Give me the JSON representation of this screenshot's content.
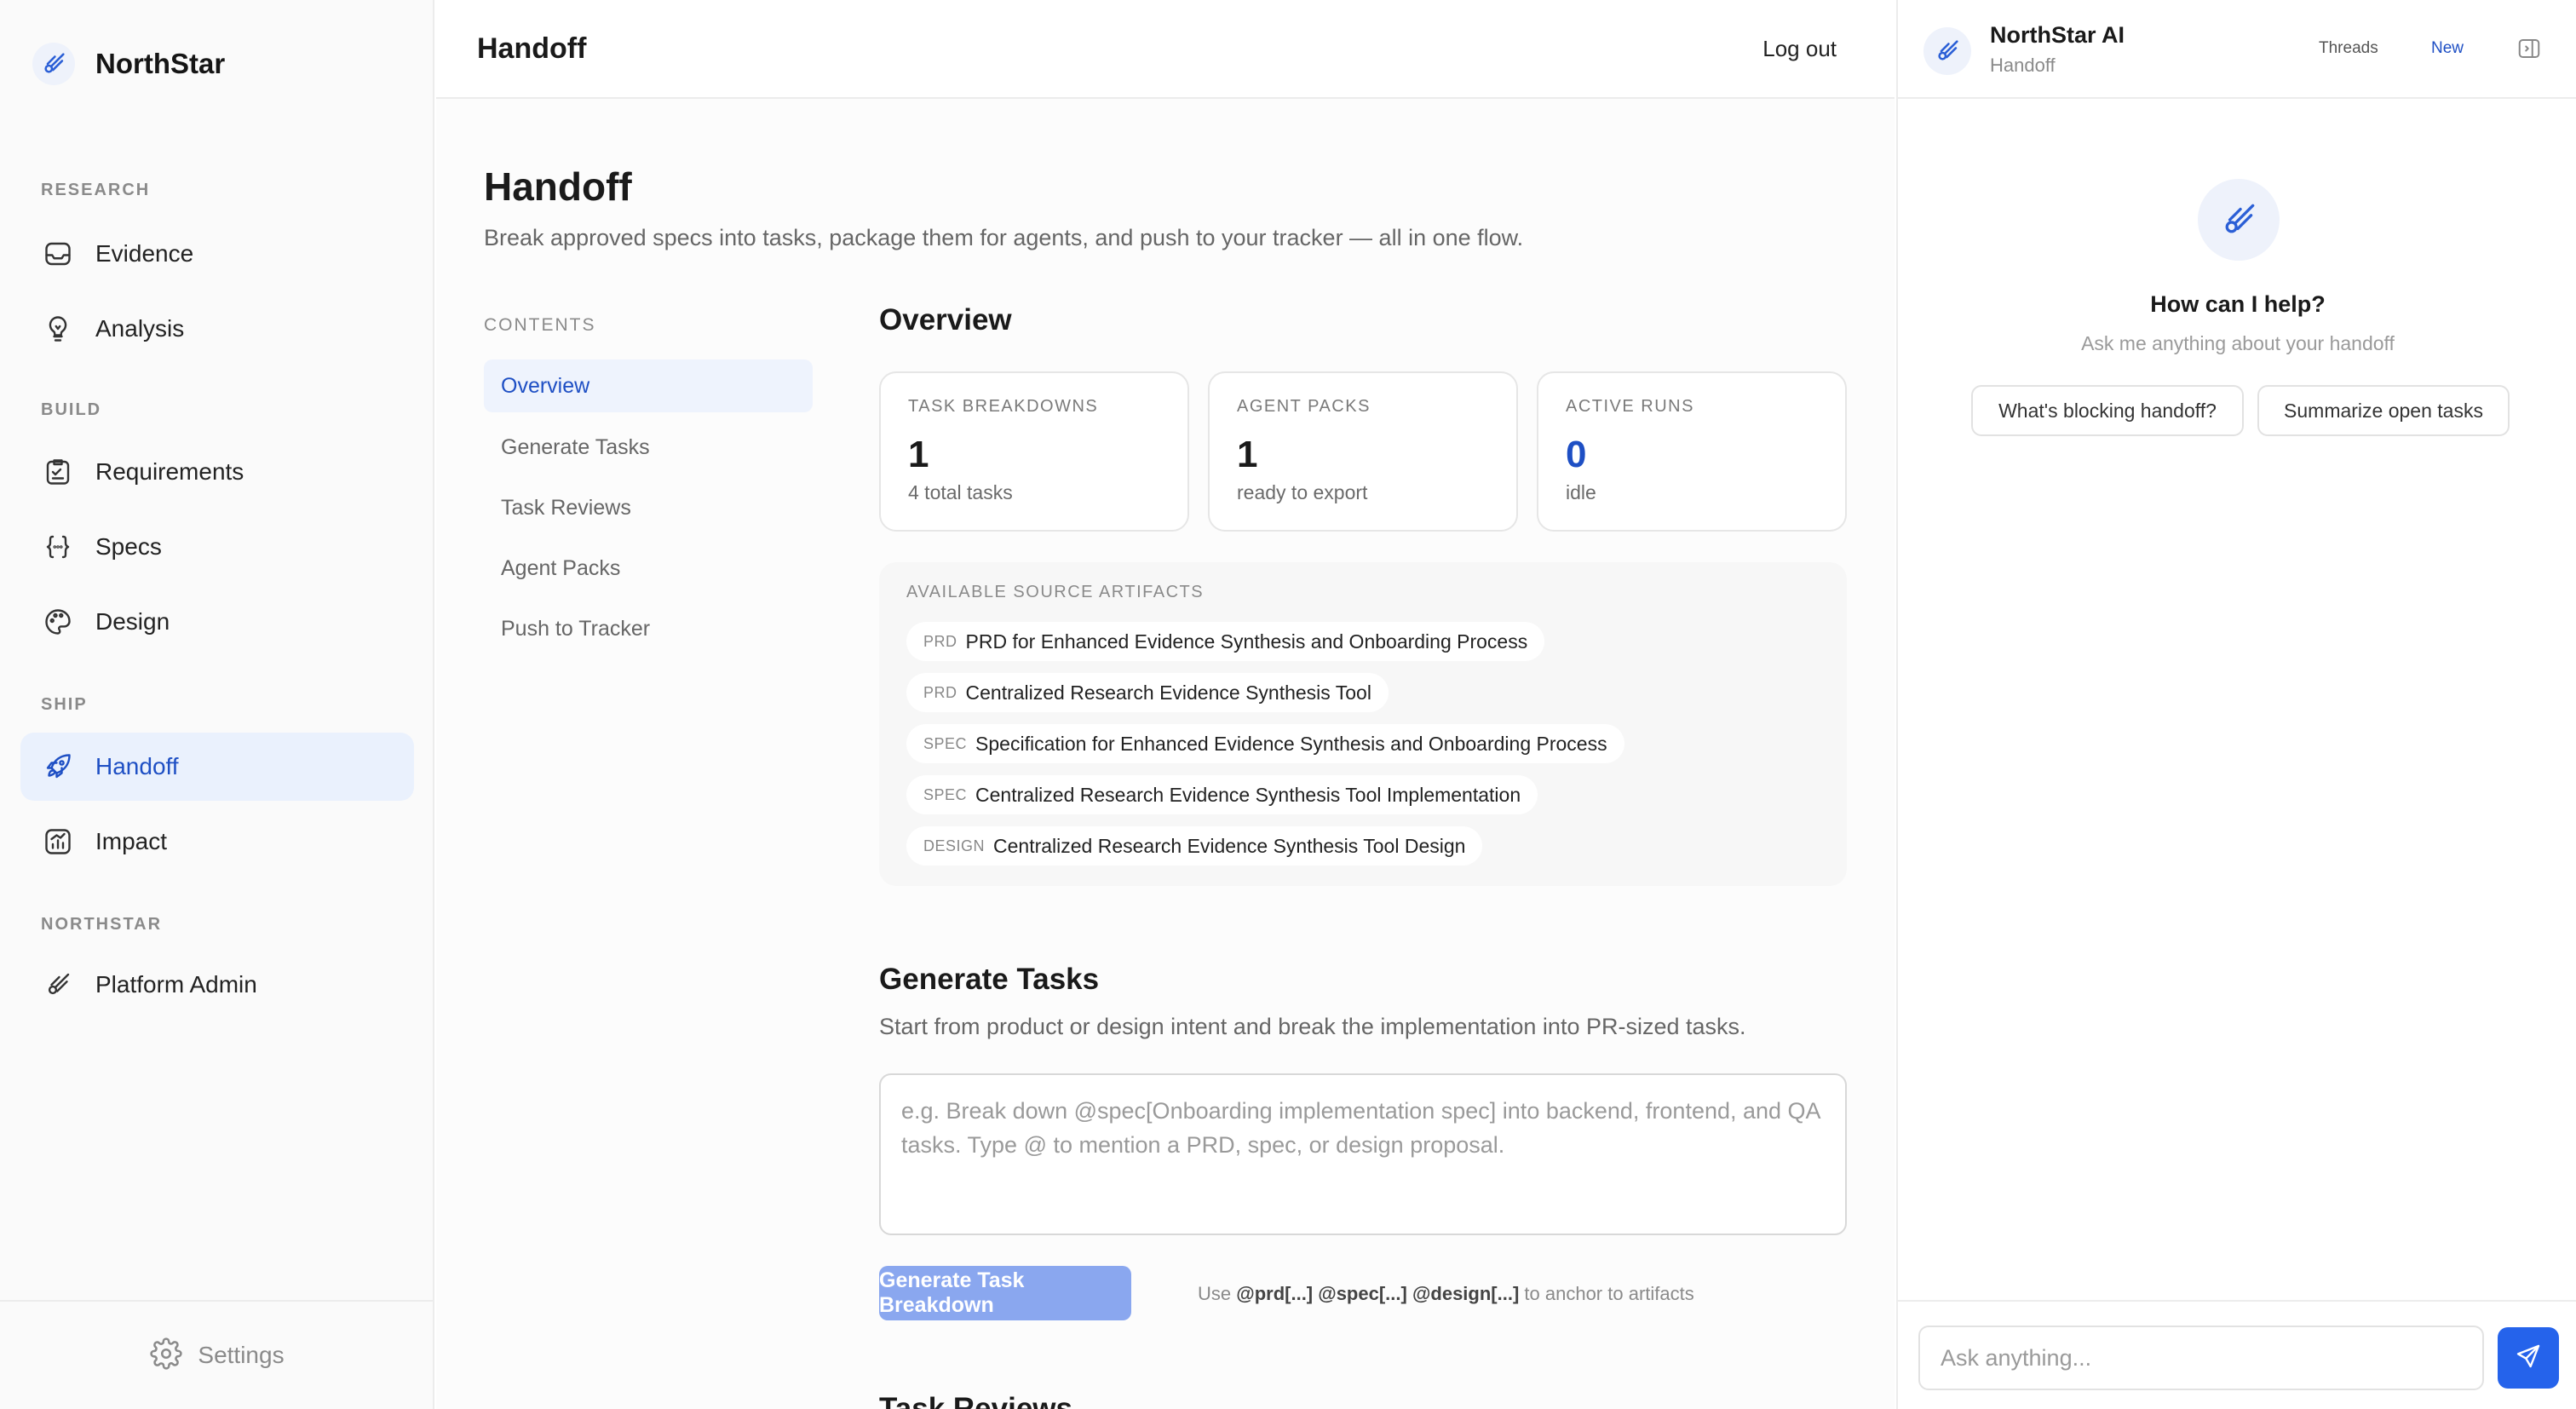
{
  "brand": {
    "name": "NorthStar",
    "icon": "comet-icon"
  },
  "sidebar": {
    "sections": [
      "RESEARCH",
      "BUILD",
      "SHIP",
      "NORTHSTAR"
    ],
    "items": [
      {
        "label": "Evidence",
        "icon": "inbox-icon"
      },
      {
        "label": "Analysis",
        "icon": "lightbulb-icon"
      },
      {
        "label": "Requirements",
        "icon": "clipboard-icon"
      },
      {
        "label": "Specs",
        "icon": "braces-icon"
      },
      {
        "label": "Design",
        "icon": "palette-icon"
      },
      {
        "label": "Handoff",
        "icon": "rocket-icon",
        "active": true
      },
      {
        "label": "Impact",
        "icon": "chart-icon"
      },
      {
        "label": "Platform Admin",
        "icon": "comet-icon"
      }
    ],
    "settings_label": "Settings"
  },
  "topbar": {
    "title": "Handoff",
    "logout_label": "Log out"
  },
  "page": {
    "title": "Handoff",
    "subtitle": "Break approved specs into tasks, package them for agents, and push to your tracker — all in one flow."
  },
  "toc": {
    "heading": "CONTENTS",
    "items": [
      "Overview",
      "Generate Tasks",
      "Task Reviews",
      "Agent Packs",
      "Push to Tracker"
    ]
  },
  "overview": {
    "title": "Overview",
    "stats": [
      {
        "label": "TASK BREAKDOWNS",
        "value": "1",
        "note": "4 total tasks"
      },
      {
        "label": "AGENT PACKS",
        "value": "1",
        "note": "ready to export"
      },
      {
        "label": "ACTIVE RUNS",
        "value": "0",
        "note": "idle"
      }
    ],
    "artifacts_heading": "AVAILABLE SOURCE ARTIFACTS",
    "artifacts": [
      {
        "tag": "PRD",
        "name": "PRD for Enhanced Evidence Synthesis and Onboarding Process"
      },
      {
        "tag": "PRD",
        "name": "Centralized Research Evidence Synthesis Tool"
      },
      {
        "tag": "SPEC",
        "name": "Specification for Enhanced Evidence Synthesis and Onboarding Process"
      },
      {
        "tag": "SPEC",
        "name": "Centralized Research Evidence Synthesis Tool Implementation"
      },
      {
        "tag": "DESIGN",
        "name": "Centralized Research Evidence Synthesis Tool Design"
      }
    ]
  },
  "generate": {
    "title": "Generate Tasks",
    "subtitle": "Start from product or design intent and break the implementation into PR-sized tasks.",
    "placeholder": "e.g. Break down @spec[Onboarding implementation spec] into backend, frontend, and QA tasks. Type @ to mention a PRD, spec, or design proposal.",
    "button_label": "Generate Task Breakdown",
    "hint_prefix": "Use",
    "hint_tokens": "@prd[...] @spec[...] @design[...]",
    "hint_suffix": "to anchor to artifacts"
  },
  "next_section_title": "Task Reviews",
  "ai": {
    "name": "NorthStar AI",
    "context": "Handoff",
    "threads_label": "Threads",
    "new_label": "New",
    "help_title": "How can I help?",
    "help_sub": "Ask me anything about your handoff",
    "suggestions": [
      "What's blocking handoff?",
      "Summarize open tasks"
    ],
    "input_placeholder": "Ask anything..."
  },
  "colors": {
    "accent": "#1e4fc4",
    "send": "#2563eb",
    "button_disabled": "#8aa7ef"
  }
}
